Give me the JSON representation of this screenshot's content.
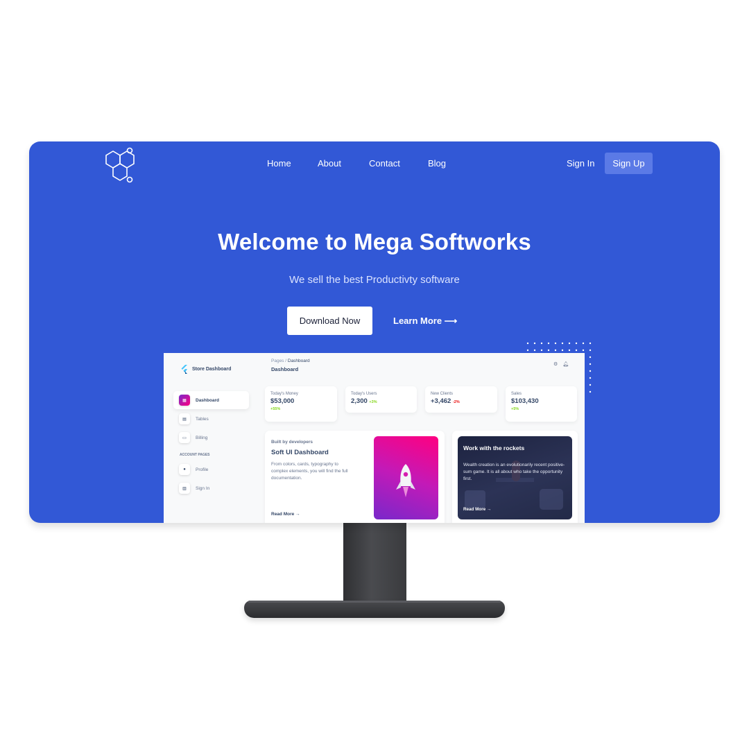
{
  "nav": {
    "items": [
      "Home",
      "About",
      "Contact",
      "Blog"
    ],
    "sign_in": "Sign In",
    "sign_up": "Sign Up"
  },
  "hero": {
    "title": "Welcome to Mega Softworks",
    "subtitle": "We sell the best Productivty software",
    "download_label": "Download Now",
    "learn_more_label": "Learn More ⟶"
  },
  "dashboard": {
    "brand": "Store Dashboard",
    "breadcrumb_root": "Pages",
    "breadcrumb_sep": "/",
    "breadcrumb_current": "Dashboard",
    "page_title": "Dashboard",
    "sidebar": {
      "items": [
        "Dashboard",
        "Tables",
        "Billing"
      ],
      "section": "ACCOUNT PAGES",
      "account_items": [
        "Profile",
        "Sign In"
      ]
    },
    "stats": [
      {
        "label": "Today's Money",
        "value": "$53,000",
        "change": "+55%"
      },
      {
        "label": "Today's Users",
        "value": "2,300",
        "change": "+3%"
      },
      {
        "label": "New Clients",
        "value": "+3,462",
        "change": "-2%"
      },
      {
        "label": "Sales",
        "value": "$103,430",
        "change": "+5%"
      }
    ],
    "card_dev": {
      "kicker": "Built by developers",
      "title": "Soft UI Dashboard",
      "description": "From colors, cards, typography to complex elements, you will find the full documentation.",
      "read_more": "Read More →"
    },
    "card_rockets": {
      "title": "Work with the rockets",
      "description": "Wealth creation is an evolutionarily recent positive-sum game. It is all about who take the opportunity first.",
      "read_more": "Read More →"
    }
  },
  "colors": {
    "brand_blue": "#3258d6",
    "signup_bg": "#5b7ae6",
    "positive": "#82d616",
    "negative": "#ea0606",
    "gradient_pink": "#ff0080",
    "gradient_purple": "#7928ca"
  },
  "icons": [
    "hexagon-molecule-logo",
    "flutter-logo",
    "gear-icon",
    "bell-icon",
    "rocket-icon"
  ]
}
